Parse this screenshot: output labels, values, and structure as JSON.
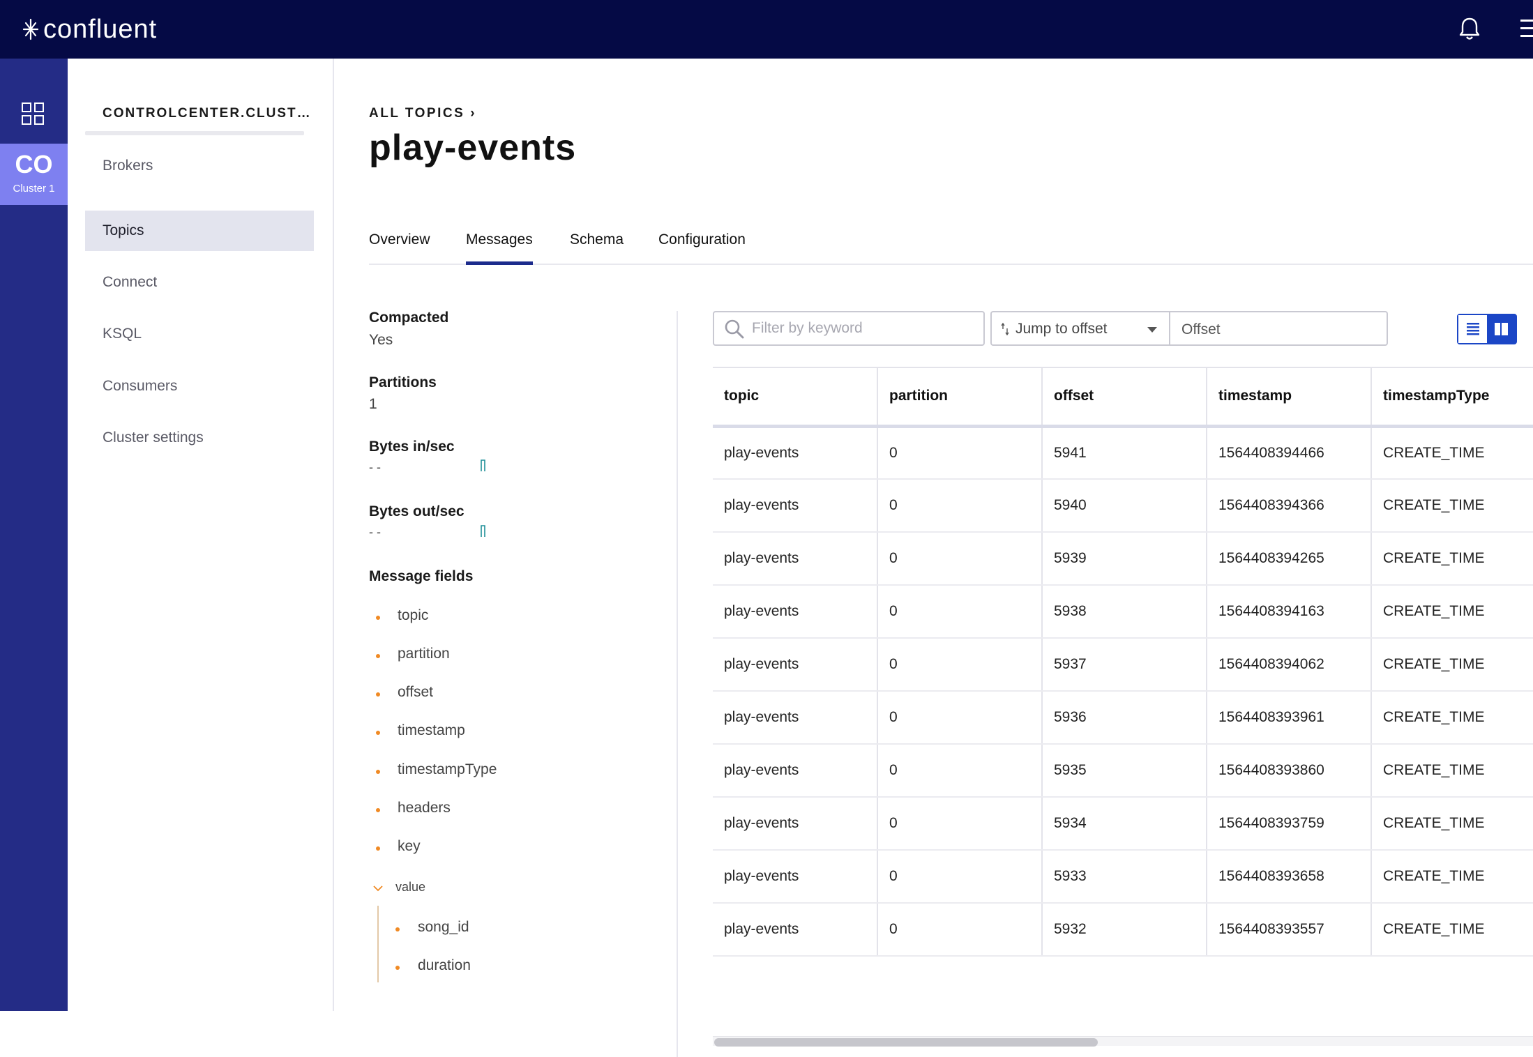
{
  "brand": {
    "name": "confluent"
  },
  "header": {
    "bell_icon": "bell-icon",
    "menu_icon": "hamburger-icon"
  },
  "rail": {
    "apps_icon": "grid-icon",
    "cluster": {
      "abbr": "CO",
      "name": "Cluster 1",
      "color": "#7e80f0"
    }
  },
  "subnav": {
    "cluster_title": "CONTROLCENTER.CLUST…",
    "items": [
      {
        "label": "Brokers",
        "active": false
      },
      {
        "label": "Topics",
        "active": true
      },
      {
        "label": "Connect",
        "active": false
      },
      {
        "label": "KSQL",
        "active": false
      },
      {
        "label": "Consumers",
        "active": false
      },
      {
        "label": "Cluster settings",
        "active": false
      }
    ]
  },
  "breadcrumb": {
    "label": "ALL TOPICS",
    "chevron": "›"
  },
  "page_title": "play-events",
  "tabs": [
    {
      "label": "Overview",
      "active": false
    },
    {
      "label": "Messages",
      "active": true
    },
    {
      "label": "Schema",
      "active": false
    },
    {
      "label": "Configuration",
      "active": false
    }
  ],
  "info": {
    "compacted": {
      "label": "Compacted",
      "value": "Yes"
    },
    "partitions": {
      "label": "Partitions",
      "value": "1"
    },
    "bytes_in": {
      "label": "Bytes in/sec",
      "value": "- -"
    },
    "bytes_out": {
      "label": "Bytes out/sec",
      "value": "- -"
    },
    "message_fields_label": "Message fields",
    "fields": [
      "topic",
      "partition",
      "offset",
      "timestamp",
      "timestampType",
      "headers",
      "key"
    ],
    "value_label": "value",
    "value_fields": [
      "song_id",
      "duration"
    ]
  },
  "toolbar": {
    "filter_placeholder": "Filter by keyword",
    "jump_label": "Jump to offset",
    "offset_placeholder": "Offset",
    "accent": "#1b46c6"
  },
  "table": {
    "columns": [
      "topic",
      "partition",
      "offset",
      "timestamp",
      "timestampType"
    ],
    "rows": [
      [
        "play-events",
        "0",
        "5941",
        "1564408394466",
        "CREATE_TIME"
      ],
      [
        "play-events",
        "0",
        "5940",
        "1564408394366",
        "CREATE_TIME"
      ],
      [
        "play-events",
        "0",
        "5939",
        "1564408394265",
        "CREATE_TIME"
      ],
      [
        "play-events",
        "0",
        "5938",
        "1564408394163",
        "CREATE_TIME"
      ],
      [
        "play-events",
        "0",
        "5937",
        "1564408394062",
        "CREATE_TIME"
      ],
      [
        "play-events",
        "0",
        "5936",
        "1564408393961",
        "CREATE_TIME"
      ],
      [
        "play-events",
        "0",
        "5935",
        "1564408393860",
        "CREATE_TIME"
      ],
      [
        "play-events",
        "0",
        "5934",
        "1564408393759",
        "CREATE_TIME"
      ],
      [
        "play-events",
        "0",
        "5933",
        "1564408393658",
        "CREATE_TIME"
      ],
      [
        "play-events",
        "0",
        "5932",
        "1564408393557",
        "CREATE_TIME"
      ]
    ]
  }
}
